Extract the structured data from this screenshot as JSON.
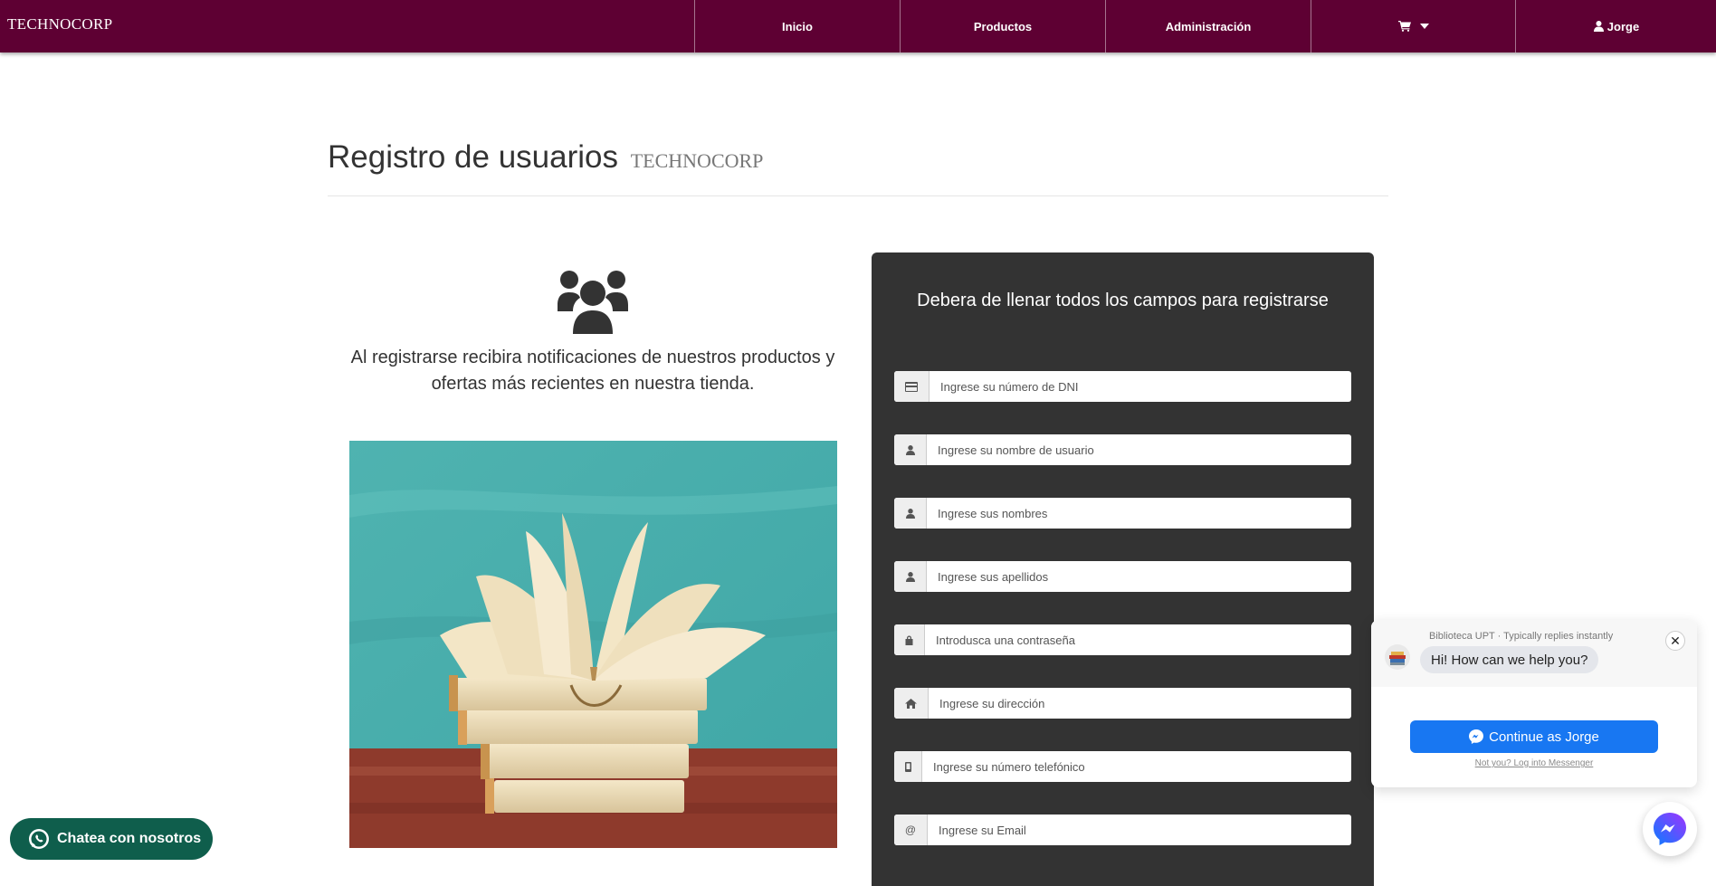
{
  "navbar": {
    "brand": "TECHNOCORP",
    "items": [
      {
        "label": "Inicio"
      },
      {
        "label": "Productos"
      },
      {
        "label": "Administración"
      },
      {
        "label": ""
      },
      {
        "label": "Jorge"
      }
    ],
    "icons": {
      "cart": "shopping-cart-icon",
      "caret": "caret-down-icon",
      "user": "user-icon"
    },
    "background": "#5e0033"
  },
  "page": {
    "title": "Registro de usuarios",
    "subtitle": "TECHNOCORP",
    "intro": "Al registrarse recibira notificaciones de nuestros productos y ofertas más recientes en nuestra tienda."
  },
  "form": {
    "title": "Debera de llenar todos los campos para registrarse",
    "fields": [
      {
        "icon": "credit-card-icon",
        "placeholder": "Ingrese su número de DNI"
      },
      {
        "icon": "user-icon",
        "placeholder": "Ingrese su nombre de usuario"
      },
      {
        "icon": "user-icon",
        "placeholder": "Ingrese sus nombres"
      },
      {
        "icon": "user-icon",
        "placeholder": "Ingrese sus apellidos"
      },
      {
        "icon": "lock-icon",
        "placeholder": "Introdusca una contraseña"
      },
      {
        "icon": "home-icon",
        "placeholder": "Ingrese su dirección"
      },
      {
        "icon": "mobile-icon",
        "placeholder": "Ingrese su número telefónico"
      },
      {
        "icon": "at-icon",
        "placeholder": "Ingrese su Email"
      }
    ],
    "background": "#333333"
  },
  "whatsapp": {
    "label": "Chatea con nosotros",
    "color": "#0f5e4c"
  },
  "messenger": {
    "page_name": "Biblioteca UPT",
    "reply_time": "Typically replies instantly",
    "greeting": "Hi! How can we help you?",
    "continue_label": "Continue as Jorge",
    "alt_login": "Not you? Log into Messenger",
    "accent": "#1877f2"
  }
}
